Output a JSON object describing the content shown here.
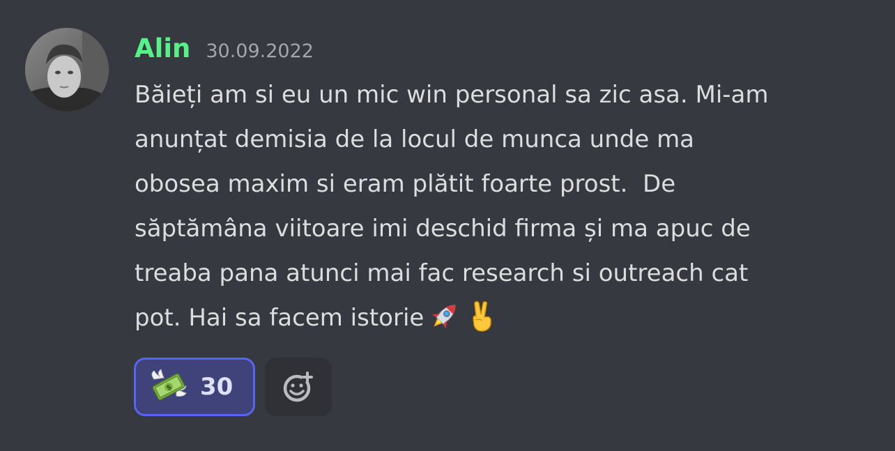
{
  "message": {
    "author": "Alin",
    "timestamp": "30.09.2022",
    "text": "Băieți am si eu un mic win personal sa zic asa. Mi-am\nanunțat demisia de la locul de munca unde ma\nobosea maxim si eram plătit foarte prost.  De\nsăptămâna viitoare imi deschid firma și ma apuc de\ntreaba pana atunci mai fac research si outreach cat\npot. Hai sa facem istorie",
    "inline_emojis": [
      "rocket-emoji",
      "victory-hand-emoji"
    ]
  },
  "reactions": [
    {
      "emoji": "money-with-wings-emoji",
      "count": "30",
      "selected": true
    }
  ],
  "add_reaction": {
    "icon": "add-reaction-icon"
  },
  "colors": {
    "background": "#36393f",
    "username": "#57f287",
    "timestamp": "#a3a6aa",
    "text": "#dcddde",
    "reaction_bg": "#3f4379",
    "reaction_border": "#5865f2",
    "add_reaction_bg": "#2f3136"
  }
}
